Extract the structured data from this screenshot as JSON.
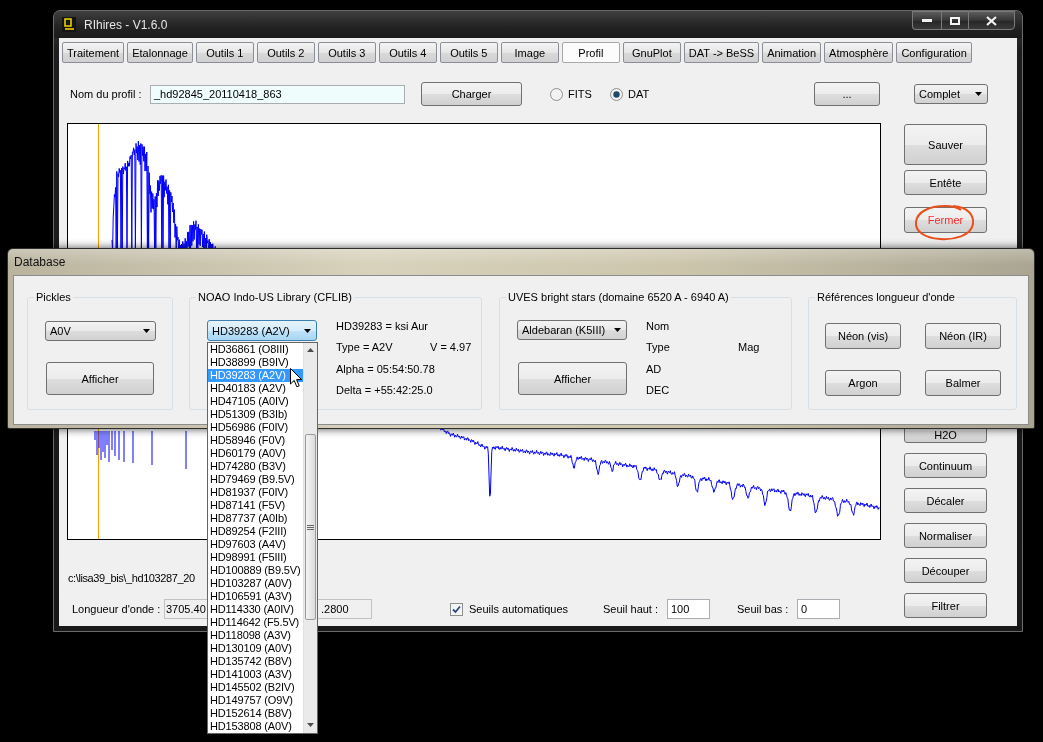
{
  "window": {
    "title": "RIhires - V1.6.0"
  },
  "tabs": [
    {
      "label": "Traitement",
      "selected": false
    },
    {
      "label": "Etalonnage",
      "selected": false
    },
    {
      "label": "Outils 1",
      "selected": false
    },
    {
      "label": "Outils 2",
      "selected": false
    },
    {
      "label": "Outils 3",
      "selected": false
    },
    {
      "label": "Outils 4",
      "selected": false
    },
    {
      "label": "Outils 5",
      "selected": false
    },
    {
      "label": "Image",
      "selected": false
    },
    {
      "label": "Profil",
      "selected": true
    },
    {
      "label": "GnuPlot",
      "selected": false
    },
    {
      "label": "DAT -> BeSS",
      "selected": false
    },
    {
      "label": "Animation",
      "selected": false
    },
    {
      "label": "Atmosphère",
      "selected": false
    },
    {
      "label": "Configuration",
      "selected": false
    }
  ],
  "profile_bar": {
    "name_label": "Nom du profil :",
    "name_value": "_hd92845_20110418_863",
    "load_button": "Charger",
    "formats": [
      {
        "label": "FITS",
        "selected": false
      },
      {
        "label": "DAT",
        "selected": true
      }
    ],
    "browse_button": "...",
    "mode_select": "Complet"
  },
  "side_buttons": [
    {
      "label": "Sauver",
      "kind": "large",
      "circled": false
    },
    {
      "label": "Entête",
      "kind": "normal",
      "circled": false
    },
    {
      "label": "Fermer",
      "kind": "warning",
      "circled": true
    }
  ],
  "side_buttons_lower": [
    {
      "label": "H2O",
      "kind": "normal",
      "circled": false
    },
    {
      "label": "Continuum",
      "kind": "normal",
      "circled": false
    },
    {
      "label": "Décaler",
      "kind": "normal",
      "circled": false
    },
    {
      "label": "Normaliser",
      "kind": "normal",
      "circled": false
    },
    {
      "label": "Découper",
      "kind": "normal",
      "circled": false
    },
    {
      "label": "Filtrer",
      "kind": "normal",
      "circled": false
    }
  ],
  "file_path": "c:\\lisa39_bis\\_hd103287_20",
  "wavelength": {
    "label": "Longueur d'onde :",
    "start": "3705.40",
    "end": ".2800"
  },
  "auto_thresholds": {
    "label": "Seuils automatiques",
    "checked": true
  },
  "upper_threshold": {
    "label": "Seuil haut :",
    "value": "100"
  },
  "lower_threshold": {
    "label": "Seuil bas :",
    "value": "0"
  },
  "dialog": {
    "title": "Database",
    "pickles": {
      "title": "Pickles",
      "select": "A0V",
      "button": "Afficher"
    },
    "cflib": {
      "title": "NOAO Indo-US Library (CFLIB)",
      "select": "HD39283 (A2V)",
      "expanded": true,
      "options": [
        {
          "label": "HD36861 (O8III)",
          "selected": false
        },
        {
          "label": "HD38899 (B9IV)",
          "selected": false
        },
        {
          "label": "HD39283 (A2V)",
          "selected": true
        },
        {
          "label": "HD40183 (A2V)",
          "selected": false
        },
        {
          "label": "HD47105 (A0IV)",
          "selected": false
        },
        {
          "label": "HD51309 (B3Ib)",
          "selected": false
        },
        {
          "label": "HD56986 (F0IV)",
          "selected": false
        },
        {
          "label": "HD58946 (F0V)",
          "selected": false
        },
        {
          "label": "HD60179 (A0V)",
          "selected": false
        },
        {
          "label": "HD74280 (B3V)",
          "selected": false
        },
        {
          "label": "HD79469 (B9.5V)",
          "selected": false
        },
        {
          "label": "HD81937 (F0IV)",
          "selected": false
        },
        {
          "label": "HD87141 (F5V)",
          "selected": false
        },
        {
          "label": "HD87737 (A0Ib)",
          "selected": false
        },
        {
          "label": "HD89254 (F2III)",
          "selected": false
        },
        {
          "label": "HD97603 (A4V)",
          "selected": false
        },
        {
          "label": "HD98991 (F5III)",
          "selected": false
        },
        {
          "label": "HD100889 (B9.5V)",
          "selected": false
        },
        {
          "label": "HD103287 (A0V)",
          "selected": false
        },
        {
          "label": "HD106591 (A3V)",
          "selected": false
        },
        {
          "label": "HD114330 (A0IV)",
          "selected": false
        },
        {
          "label": "HD114642 (F5.5V)",
          "selected": false
        },
        {
          "label": "HD118098 (A3V)",
          "selected": false
        },
        {
          "label": "HD130109 (A0V)",
          "selected": false
        },
        {
          "label": "HD135742 (B8V)",
          "selected": false
        },
        {
          "label": "HD141003 (A3V)",
          "selected": false
        },
        {
          "label": "HD145502 (B2IV)",
          "selected": false
        },
        {
          "label": "HD149757 (O9V)",
          "selected": false
        },
        {
          "label": "HD152614 (B8V)",
          "selected": false
        },
        {
          "label": "HD153808 (A0V)",
          "selected": false
        }
      ],
      "star": "HD39283 = ksi Aur",
      "type": "Type = A2V",
      "magnitude": "V = 4.97",
      "alpha": "Alpha = 05:54:50.78",
      "delta": "Delta = +55:42:25.0"
    },
    "uves": {
      "title": "UVES bright stars (domaine 6520 A - 6940 A)",
      "select": "Aldebaran (K5III)",
      "button": "Afficher",
      "name_label": "Nom",
      "type_label": "Type",
      "magnitude_label": "Mag",
      "ra_label": "AD",
      "dec_label": "DEC"
    },
    "references": {
      "title": "Références longueur d'onde",
      "buttons": [
        "Néon (vis)",
        "Néon (IR)",
        "Argon",
        "Balmer"
      ]
    }
  }
}
